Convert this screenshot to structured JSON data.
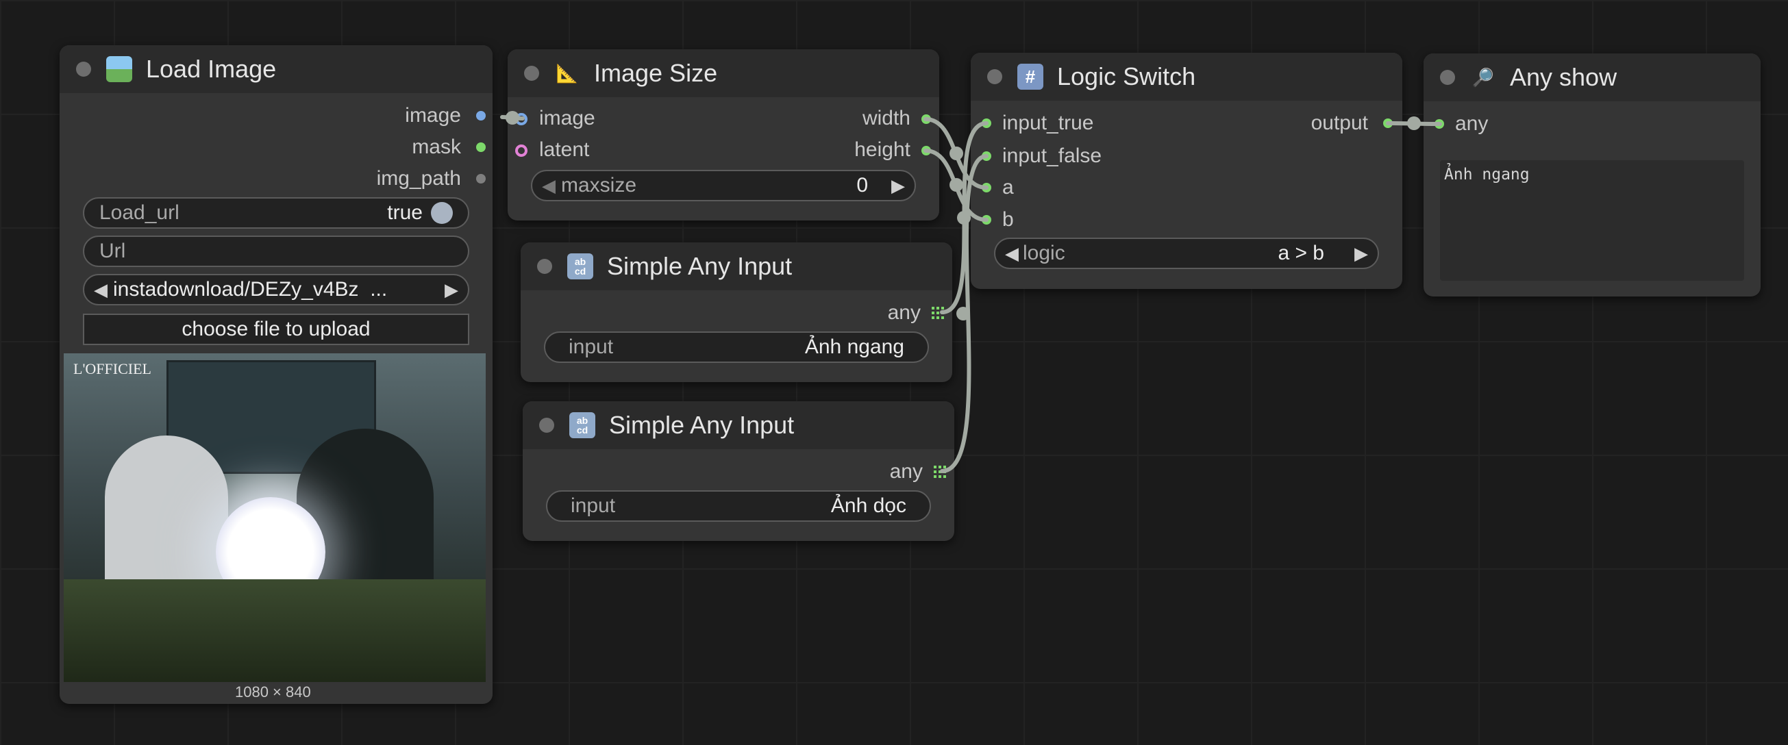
{
  "colors": {
    "canvas_bg": "#1b1b1b",
    "node_body": "#353535",
    "node_header": "#2b2b2b",
    "slot_green": "#7dd96a",
    "slot_blue": "#7aa9e6",
    "slot_pink": "#e282d6",
    "link_color": "#a3aaa2"
  },
  "nodes": {
    "load_image": {
      "title": "Load Image",
      "icon": "image-icon",
      "outputs": {
        "image": "image",
        "mask": "mask",
        "img_path": "img_path"
      },
      "widgets": {
        "load_url": {
          "label": "Load_url",
          "value": "true"
        },
        "url": {
          "label": "Url",
          "value": ""
        },
        "image_file": {
          "value": "instadownload/DEZy_v4Bz  ..."
        },
        "upload_button": "choose file to upload"
      },
      "preview": {
        "watermark": "L'OFFICIEL",
        "dimensions": "1080 × 840"
      }
    },
    "image_size": {
      "title": "Image Size",
      "icon": "triangle-ruler-icon",
      "inputs": {
        "image": "image",
        "latent": "latent"
      },
      "outputs": {
        "width": "width",
        "height": "height"
      },
      "widgets": {
        "maxsize": {
          "label": "maxsize",
          "value": "0"
        }
      }
    },
    "simple_any_input_1": {
      "title": "Simple Any Input",
      "icon": "abcd-icon",
      "outputs": {
        "any": "any"
      },
      "widgets": {
        "input": {
          "label": "input",
          "value": "Ảnh ngang"
        }
      }
    },
    "simple_any_input_2": {
      "title": "Simple Any Input",
      "icon": "abcd-icon",
      "outputs": {
        "any": "any"
      },
      "widgets": {
        "input": {
          "label": "input",
          "value": "Ảnh dọc"
        }
      }
    },
    "logic_switch": {
      "title": "Logic Switch",
      "icon": "hash-icon",
      "inputs": {
        "input_true": "input_true",
        "input_false": "input_false",
        "a": "a",
        "b": "b"
      },
      "outputs": {
        "output": "output"
      },
      "widgets": {
        "logic": {
          "label": "logic",
          "value": "a > b"
        }
      }
    },
    "any_show": {
      "title": "Any show",
      "icon": "magnifier-icon",
      "inputs": {
        "any": "any"
      },
      "display_text": "Ảnh ngang"
    }
  }
}
